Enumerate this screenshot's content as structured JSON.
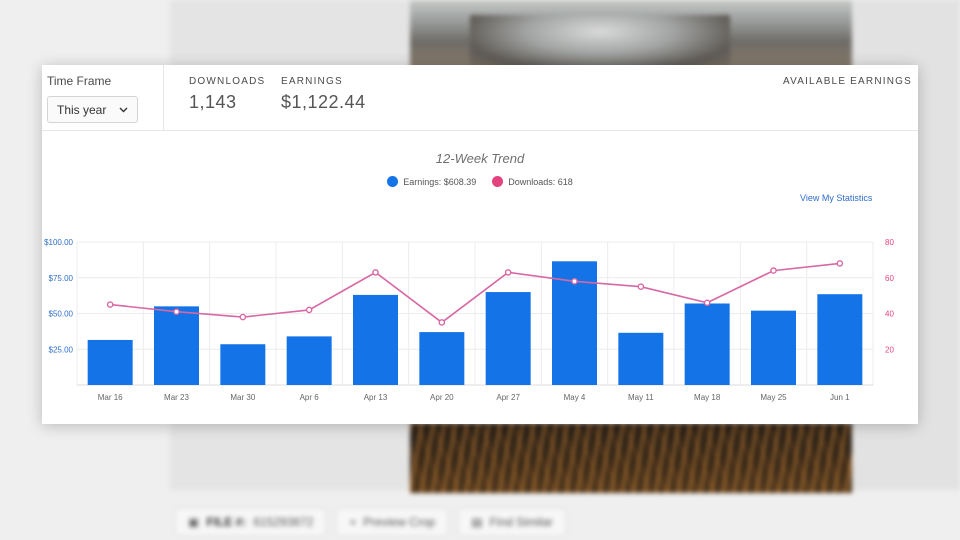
{
  "background": {
    "toolbar": {
      "file_label": "FILE #:",
      "file_number": "615293872",
      "preview_crop": "Preview Crop",
      "find_similar": "Find Similar"
    }
  },
  "stats": {
    "timeframe_label": "Time Frame",
    "timeframe_value": "This year",
    "downloads_label": "DOWNLOADS",
    "downloads_value": "1,143",
    "earnings_label": "EARNINGS",
    "earnings_value": "$1,122.44",
    "available_label": "AVAILABLE EARNINGS"
  },
  "view_link": "View My Statistics",
  "colors": {
    "earnings": "#1473e6",
    "downloads": "#e3437f",
    "downloads_line": "#d768a4"
  },
  "chart_data": {
    "type": "bar",
    "title": "12-Week Trend",
    "categories": [
      "Mar 16",
      "Mar 23",
      "Mar 30",
      "Apr 6",
      "Apr 13",
      "Apr 20",
      "Apr 27",
      "May 4",
      "May 11",
      "May 18",
      "May 25",
      "Jun 1"
    ],
    "series": [
      {
        "name": "Earnings: $608.39",
        "kind": "bar",
        "axis": "left",
        "values": [
          31.5,
          55,
          28.5,
          34,
          63,
          37,
          65,
          86.5,
          36.5,
          57,
          52,
          63.5
        ]
      },
      {
        "name": "Downloads: 618",
        "kind": "line",
        "axis": "right",
        "values": [
          45,
          41,
          38,
          42,
          63,
          35,
          63,
          58,
          55,
          46,
          64,
          68
        ]
      }
    ],
    "y_left": {
      "ticks": [
        "$100.00",
        "$75.00",
        "$50.00",
        "$25.00"
      ],
      "values": [
        100,
        75,
        50,
        25
      ],
      "range": [
        0,
        100
      ]
    },
    "y_right": {
      "ticks": [
        "80",
        "60",
        "40",
        "20"
      ],
      "values": [
        80,
        60,
        40,
        20
      ],
      "range": [
        0,
        80
      ]
    },
    "grid": true,
    "legend_position": "top-center"
  }
}
